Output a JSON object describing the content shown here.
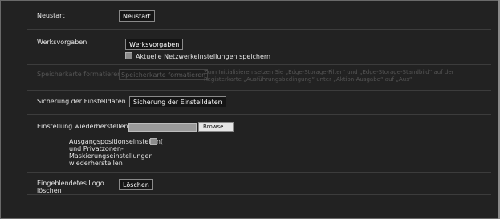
{
  "rows": {
    "restart": {
      "label": "Neustart",
      "button": "Neustart"
    },
    "factory": {
      "label": "Werksvorgaben",
      "button": "Werksvorgaben",
      "checkbox_label": "Aktuelle Netzwerkeinstellungen speichern"
    },
    "format_card": {
      "label": "Speicherkarte formatieren",
      "button": "Speicherkarte formatieren",
      "note_line1": "Zum Initialisieren setzen Sie „Edge-Storage-Filter“ und „Edge-Storage-Standbild“ auf der",
      "note_line2": "Registerkarte „Ausführungsbedingung“ unter „Aktion-Ausgabe“ auf „Aus“."
    },
    "backup": {
      "label": "Sicherung der Einstelldaten",
      "button": "Sicherung der Einstelldaten"
    },
    "restore": {
      "label": "Einstellung wiederherstellen",
      "file_value": "",
      "browse_button": "Browse...",
      "option_lines": [
        "Ausgangspositionseinstellun(",
        "und Privatzonen-",
        "Maskierungseinstellungen",
        "wiederherstellen"
      ]
    },
    "logo": {
      "label_line1": "Eingeblendetes Logo",
      "label_line2": "löschen",
      "button": "Löschen"
    }
  }
}
